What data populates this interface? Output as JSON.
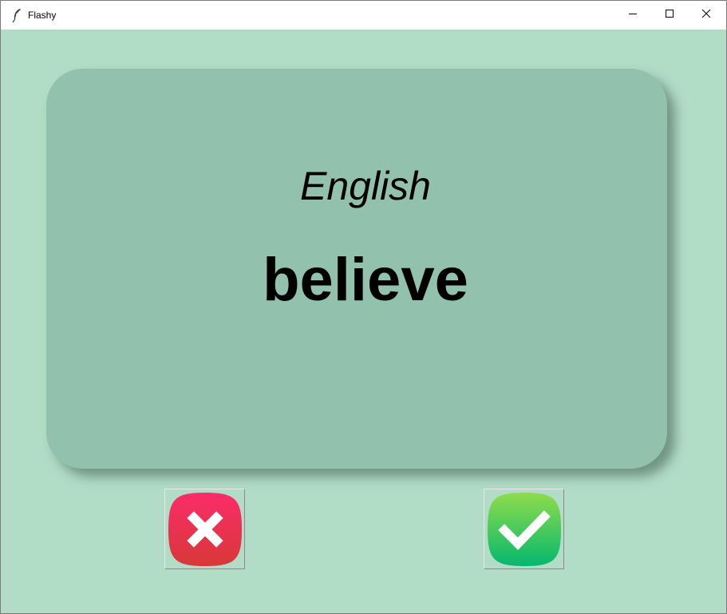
{
  "window": {
    "title": "Flashy",
    "minimize_icon": "minimize-icon",
    "maximize_icon": "maximize-icon",
    "close_icon": "close-icon"
  },
  "card": {
    "title": "English",
    "word": "believe"
  },
  "buttons": {
    "wrong_icon": "cross-icon",
    "right_icon": "check-icon"
  },
  "colors": {
    "background": "#b1dcc6",
    "card": "#92c1ae",
    "wrong": "#e8304f",
    "right": "#22c46a"
  }
}
